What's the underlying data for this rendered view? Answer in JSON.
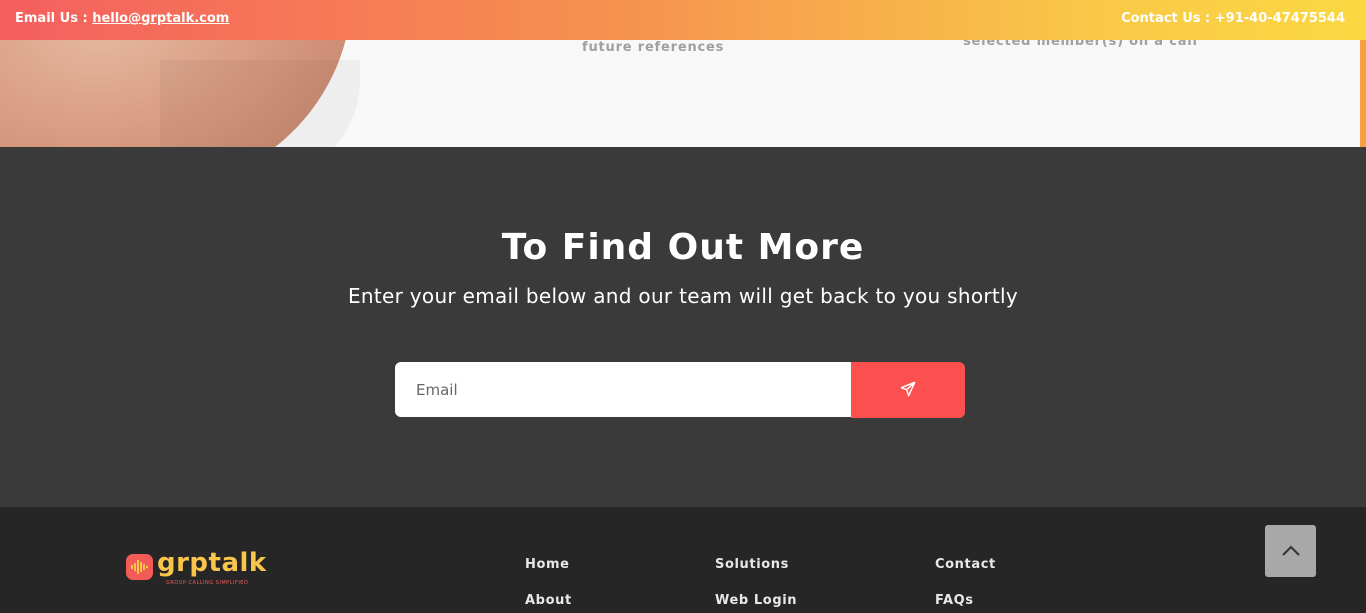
{
  "topbar": {
    "email_label": "Email Us :",
    "email": "hello@grptalk.com",
    "contact_text": "Contact Us : +91-40-47475544"
  },
  "features": {
    "text_1": "future references",
    "text_2": "selected member(s) on a call"
  },
  "cta": {
    "title": "To Find Out More",
    "subtitle": "Enter your email below and our team will get back to you shortly",
    "email_placeholder": "Email",
    "submit_icon": "send-icon"
  },
  "footer": {
    "logo_text": "grptalk",
    "logo_tagline": "GROUP CALLING SIMPLIFIED",
    "col1": [
      "Home",
      "About"
    ],
    "col2": [
      "Solutions",
      "Web Login"
    ],
    "col3": [
      "Contact",
      "FAQs"
    ]
  },
  "scroll_top_icon": "chevron-up-icon",
  "colors": {
    "topbar_start": "#f55f5f",
    "topbar_end": "#fbd843",
    "cta_bg": "#3a3a3a",
    "button": "#fc5050",
    "footer_bg": "#262626",
    "logo_yellow": "#f9c54b",
    "logo_red": "#f35b57"
  }
}
